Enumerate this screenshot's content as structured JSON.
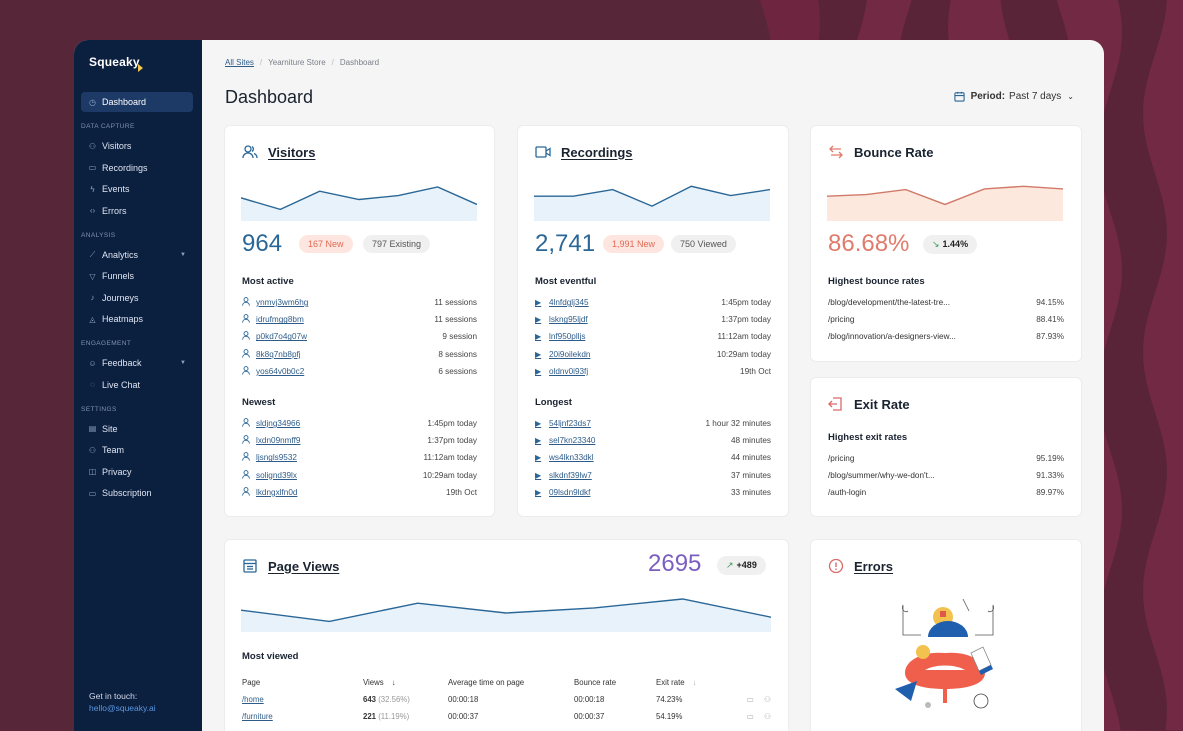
{
  "brand": {
    "name": "Squeaky"
  },
  "sidebar": {
    "dashboard": "Dashboard",
    "groups": [
      {
        "label": "DATA CAPTURE",
        "items": [
          {
            "label": "Visitors",
            "icon": "visitors-icon"
          },
          {
            "label": "Recordings",
            "icon": "recordings-icon"
          },
          {
            "label": "Events",
            "icon": "events-icon"
          },
          {
            "label": "Errors",
            "icon": "errors-icon"
          }
        ]
      },
      {
        "label": "ANALYSIS",
        "items": [
          {
            "label": "Analytics",
            "icon": "analytics-icon",
            "expandable": true
          },
          {
            "label": "Funnels",
            "icon": "funnels-icon"
          },
          {
            "label": "Journeys",
            "icon": "journeys-icon"
          },
          {
            "label": "Heatmaps",
            "icon": "heatmaps-icon"
          }
        ]
      },
      {
        "label": "ENGAGEMENT",
        "items": [
          {
            "label": "Feedback",
            "icon": "feedback-icon",
            "expandable": true
          },
          {
            "label": "Live Chat",
            "icon": "live-chat-icon"
          }
        ]
      },
      {
        "label": "SETTINGS",
        "items": [
          {
            "label": "Site",
            "icon": "site-icon"
          },
          {
            "label": "Team",
            "icon": "team-icon"
          },
          {
            "label": "Privacy",
            "icon": "privacy-icon"
          },
          {
            "label": "Subscription",
            "icon": "subscription-icon"
          }
        ]
      }
    ],
    "contact_label": "Get in touch:",
    "contact_email": "hello@squeaky.ai"
  },
  "breadcrumb": {
    "items": [
      "All Sites",
      "Yearniture Store",
      "Dashboard"
    ]
  },
  "page_title": "Dashboard",
  "period": {
    "label": "Period:",
    "value": "Past 7 days"
  },
  "colors": {
    "accent": "#2a6797",
    "bounce": "#e07a6a",
    "pageviews": "#7b5fc0",
    "sidebar": "#0b1f3f"
  },
  "visitors": {
    "title": "Visitors",
    "total": "964",
    "new_badge": "167 New",
    "existing_badge": "797 Existing",
    "trend": [
      0.55,
      0.2,
      0.75,
      0.5,
      0.62,
      0.88,
      0.35
    ],
    "most_active_title": "Most active",
    "most_active": [
      {
        "id": "ynmvj3wm6hg",
        "value": "11 sessions"
      },
      {
        "id": "idrufmgg8bm",
        "value": "11 sessions"
      },
      {
        "id": "p0kd7o4g07w",
        "value": "9 session"
      },
      {
        "id": "8k8q7nb8pfj",
        "value": "8 sessions"
      },
      {
        "id": "yos64v0b0c2",
        "value": "6 sessions"
      }
    ],
    "newest_title": "Newest",
    "newest": [
      {
        "id": "sldjng34966",
        "value": "1:45pm today"
      },
      {
        "id": "lxdn09nmff9",
        "value": "1:37pm today"
      },
      {
        "id": "ljsngls9532",
        "value": "11:12am today"
      },
      {
        "id": "solignd39lx",
        "value": "10:29am today"
      },
      {
        "id": "lkdngxlfn0d",
        "value": "19th Oct"
      }
    ]
  },
  "recordings": {
    "title": "Recordings",
    "total": "2,741",
    "new_badge": "1,991 New",
    "viewed_badge": "750 Viewed",
    "trend": [
      0.6,
      0.6,
      0.8,
      0.3,
      0.9,
      0.62,
      0.8
    ],
    "most_eventful_title": "Most eventful",
    "most_eventful": [
      {
        "id": "4lnfdglj345",
        "value": "1:45pm today"
      },
      {
        "id": "lskng95ljdf",
        "value": "1:37pm today"
      },
      {
        "id": "lnf950plljs",
        "value": "11:12am today"
      },
      {
        "id": "20i9oilekdn",
        "value": "10:29am today"
      },
      {
        "id": "oldnv0i93fj",
        "value": "19th Oct"
      }
    ],
    "longest_title": "Longest",
    "longest": [
      {
        "id": "54ljnf23ds7",
        "value": "1 hour 32 minutes"
      },
      {
        "id": "sel7kn23340",
        "value": "48 minutes"
      },
      {
        "id": "ws4lkn33dkl",
        "value": "44 minutes"
      },
      {
        "id": "slkdnf39lw7",
        "value": "37 minutes"
      },
      {
        "id": "09lsdn9ldkf",
        "value": "33 minutes"
      }
    ]
  },
  "bounce_rate": {
    "title": "Bounce Rate",
    "value": "86.68%",
    "change": "1.44%",
    "change_direction": "down",
    "trend": [
      0.6,
      0.65,
      0.8,
      0.35,
      0.82,
      0.9,
      0.82
    ],
    "list_title": "Highest bounce rates",
    "items": [
      {
        "page": "/blog/development/the-latest-tre...",
        "value": "94.15%"
      },
      {
        "page": "/pricing",
        "value": "88.41%"
      },
      {
        "page": "/blog/innovation/a-designers-view...",
        "value": "87.93%"
      }
    ]
  },
  "exit_rate": {
    "title": "Exit Rate",
    "list_title": "Highest exit rates",
    "items": [
      {
        "page": "/pricing",
        "value": "95.19%"
      },
      {
        "page": "/blog/summer/why-we-don't...",
        "value": "91.33%"
      },
      {
        "page": "/auth-login",
        "value": "89.97%"
      }
    ]
  },
  "page_views": {
    "title": "Page Views",
    "total": "2695",
    "change": "+489",
    "change_direction": "up",
    "trend": [
      0.6,
      0.2,
      0.85,
      0.5,
      0.68,
      1.0,
      0.35
    ],
    "most_viewed_title": "Most viewed",
    "columns": [
      "Page",
      "Views",
      "Average time on page",
      "Bounce rate",
      "Exit rate"
    ],
    "rows": [
      {
        "page": "/home",
        "views": "643",
        "views_pct": "(32.56%)",
        "avg_time": "00:00:18",
        "bounce": "00:00:18",
        "exit": "74.23%"
      },
      {
        "page": "/furniture",
        "views": "221",
        "views_pct": "(11.19%)",
        "avg_time": "00:00:37",
        "bounce": "00:00:37",
        "exit": "54.19%"
      }
    ]
  },
  "errors": {
    "title": "Errors"
  }
}
